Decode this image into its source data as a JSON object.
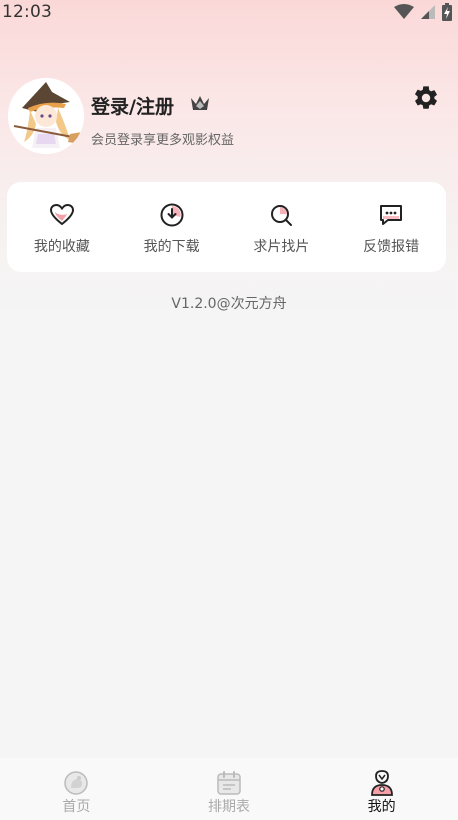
{
  "status_bar": {
    "time": "12:03"
  },
  "profile": {
    "login_label": "登录/注册",
    "subtitle": "会员登录享更多观影权益"
  },
  "actions": [
    {
      "label": "我的收藏",
      "icon": "heart-icon"
    },
    {
      "label": "我的下载",
      "icon": "download-icon"
    },
    {
      "label": "求片找片",
      "icon": "search-icon"
    },
    {
      "label": "反馈报错",
      "icon": "feedback-icon"
    }
  ],
  "version": "V1.2.0@次元方舟",
  "bottom_nav": [
    {
      "label": "首页",
      "icon": "home-icon",
      "active": false
    },
    {
      "label": "排期表",
      "icon": "calendar-icon",
      "active": false
    },
    {
      "label": "我的",
      "icon": "profile-icon",
      "active": true
    }
  ],
  "colors": {
    "accent_pink": "#f5a0a8",
    "background": "#f5f5f5",
    "card": "#ffffff"
  }
}
